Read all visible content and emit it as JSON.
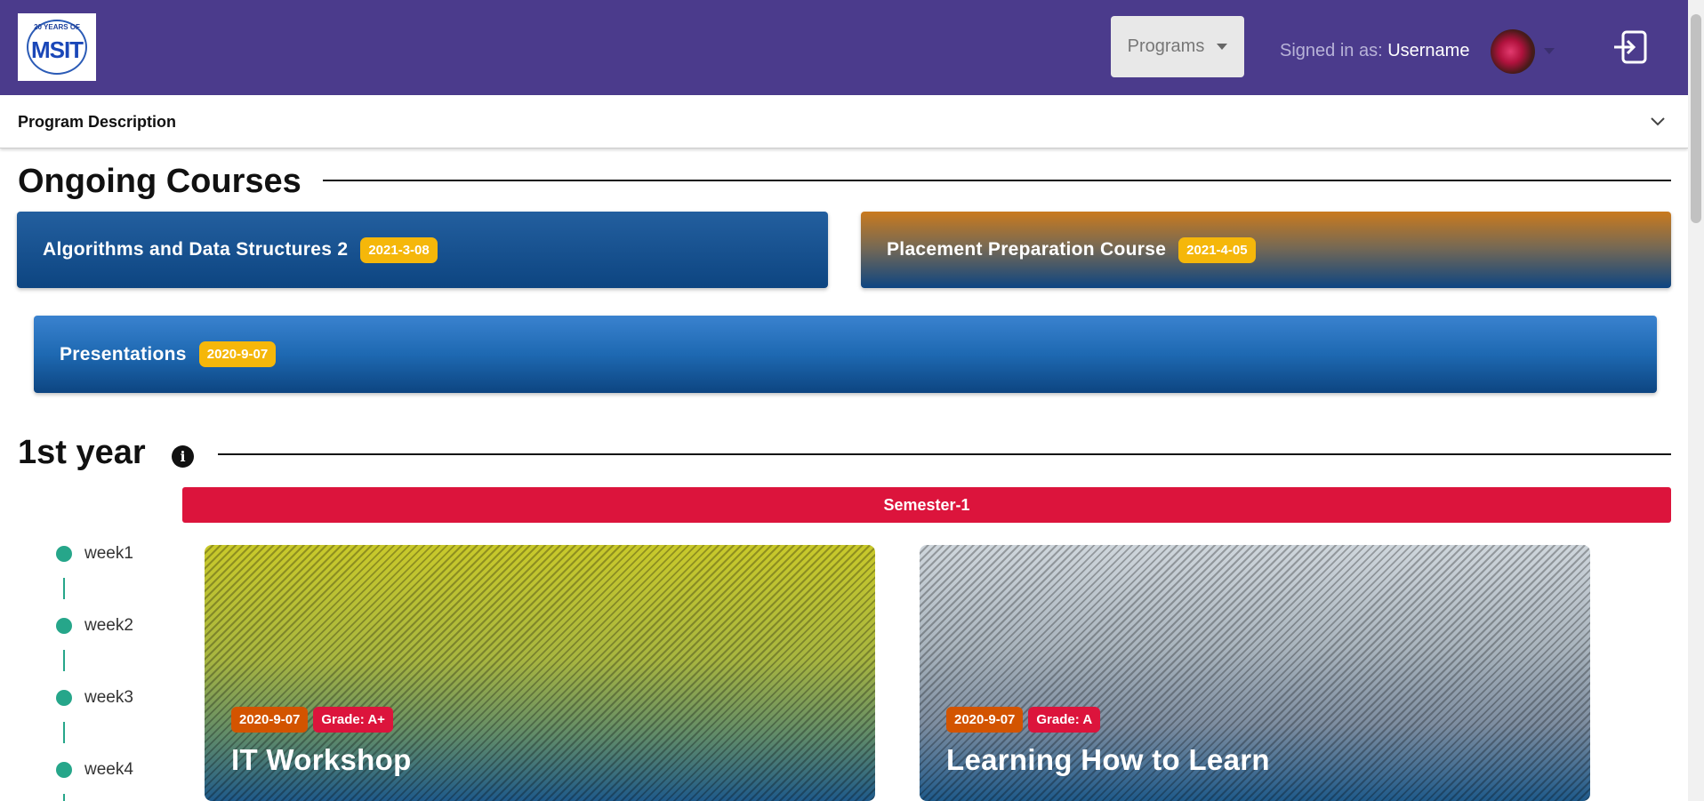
{
  "header": {
    "logo_years": "20 YEARS OF",
    "logo_text": "MSIT",
    "programs_label": "Programs",
    "signed_in_prefix": "Signed in as:",
    "username": "Username"
  },
  "program_description": {
    "title": "Program Description"
  },
  "ongoing": {
    "title": "Ongoing Courses",
    "courses": [
      {
        "name": "Algorithms and Data Structures 2",
        "date": "2021-3-08"
      },
      {
        "name": "Placement Preparation Course",
        "date": "2021-4-05"
      },
      {
        "name": "Presentations",
        "date": "2020-9-07"
      }
    ]
  },
  "year": {
    "title": "1st year",
    "semester": "Semester-1",
    "weeks": [
      "week1",
      "week2",
      "week3",
      "week4"
    ],
    "cards": [
      {
        "title": "IT Workshop",
        "date": "2020-9-07",
        "grade": "Grade: A+"
      },
      {
        "title": "Learning How to Learn",
        "date": "2020-9-07",
        "grade": "Grade: A"
      }
    ]
  },
  "colors": {
    "navbar": "#4b3b8c",
    "badge_yellow": "#f5b70a",
    "semester_red": "#dc143c",
    "timeline_green": "#26a68a",
    "date_orange": "#d35400"
  },
  "icons": {
    "programs": "chevron-down-icon",
    "avatar_menu": "caret-down-icon",
    "logout": "logout-icon",
    "description": "chevron-down-icon",
    "info": "info-icon"
  }
}
